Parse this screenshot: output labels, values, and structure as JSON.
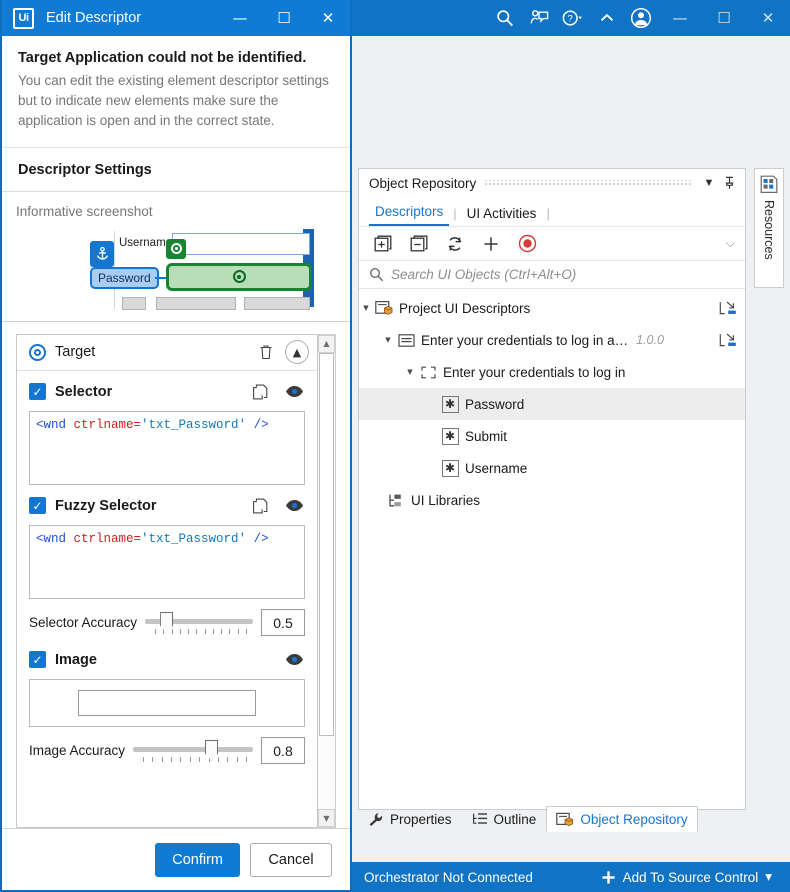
{
  "dialog": {
    "logo": "Ui",
    "title": "Edit Descriptor",
    "window_controls": {
      "minimize": "—",
      "maximize": "☐",
      "close": "✕"
    },
    "notice": {
      "title": "Target Application could not be identified.",
      "body": "You can edit the existing element descriptor settings but to indicate new elements make sure the application is open and in the correct state."
    },
    "section_heading": "Descriptor Settings",
    "informative_screenshot": {
      "label": "Informative screenshot",
      "username_label": "Username",
      "anchor_label": "Password"
    },
    "target_panel": {
      "title": "Target",
      "selector": {
        "label": "Selector",
        "value_tag": "<wnd",
        "value_attr": "ctrlname=",
        "value_val": "'txt_Password'",
        "value_close": "/>"
      },
      "fuzzy_selector": {
        "label": "Fuzzy Selector",
        "value_tag": "<wnd",
        "value_attr": "ctrlname=",
        "value_val": "'txt_Password'",
        "value_close": "/>"
      },
      "selector_accuracy": {
        "label": "Selector Accuracy",
        "value": "0.5"
      },
      "image": {
        "label": "Image"
      },
      "image_accuracy": {
        "label": "Image Accuracy",
        "value": "0.8"
      }
    },
    "footer": {
      "confirm": "Confirm",
      "cancel": "Cancel"
    }
  },
  "studio": {
    "titlebar_controls": {
      "minimize": "—",
      "maximize": "☐",
      "close": "✕"
    },
    "object_repository": {
      "title": "Object Repository",
      "tabs": [
        {
          "label": "Descriptors",
          "active": true
        },
        {
          "label": "UI Activities",
          "active": false
        }
      ],
      "search_placeholder": "Search UI Objects (Ctrl+Alt+O)",
      "tree": [
        {
          "label": "Project UI Descriptors",
          "version": "",
          "depth": 0,
          "icon": "project-icon",
          "expanded": true,
          "selected": false,
          "trail": true
        },
        {
          "label": "Enter your credentials to log in a…",
          "version": "1.0.0",
          "depth": 1,
          "icon": "app-icon",
          "expanded": true,
          "selected": false,
          "trail": true
        },
        {
          "label": "Enter your credentials to log in",
          "version": "",
          "depth": 2,
          "icon": "screen-icon",
          "expanded": true,
          "selected": false,
          "trail": false
        },
        {
          "label": "Password",
          "version": "",
          "depth": 3,
          "icon": "element-icon",
          "expanded": false,
          "selected": true,
          "trail": false
        },
        {
          "label": "Submit",
          "version": "",
          "depth": 3,
          "icon": "element-icon",
          "expanded": false,
          "selected": false,
          "trail": false
        },
        {
          "label": "Username",
          "version": "",
          "depth": 3,
          "icon": "element-icon",
          "expanded": false,
          "selected": false,
          "trail": false
        },
        {
          "label": "UI Libraries",
          "version": "",
          "depth": 0.5,
          "icon": "library-icon",
          "expanded": false,
          "selected": false,
          "trail": false
        }
      ]
    },
    "resources_strip": {
      "label": "Resources"
    },
    "bottom_tabs": [
      {
        "label": "Properties",
        "active": false
      },
      {
        "label": "Outline",
        "active": false
      },
      {
        "label": "Object Repository",
        "active": true
      }
    ],
    "statusbar": {
      "orchestrator": "Orchestrator Not Connected",
      "source_control": "Add To Source Control",
      "caret": "▾"
    }
  },
  "colors": {
    "accent_blue": "#0f7bd4",
    "studio_blue": "#1173c4",
    "link_blue": "#1675d1",
    "target_green": "#15862f",
    "record_red": "#d43c3c"
  }
}
